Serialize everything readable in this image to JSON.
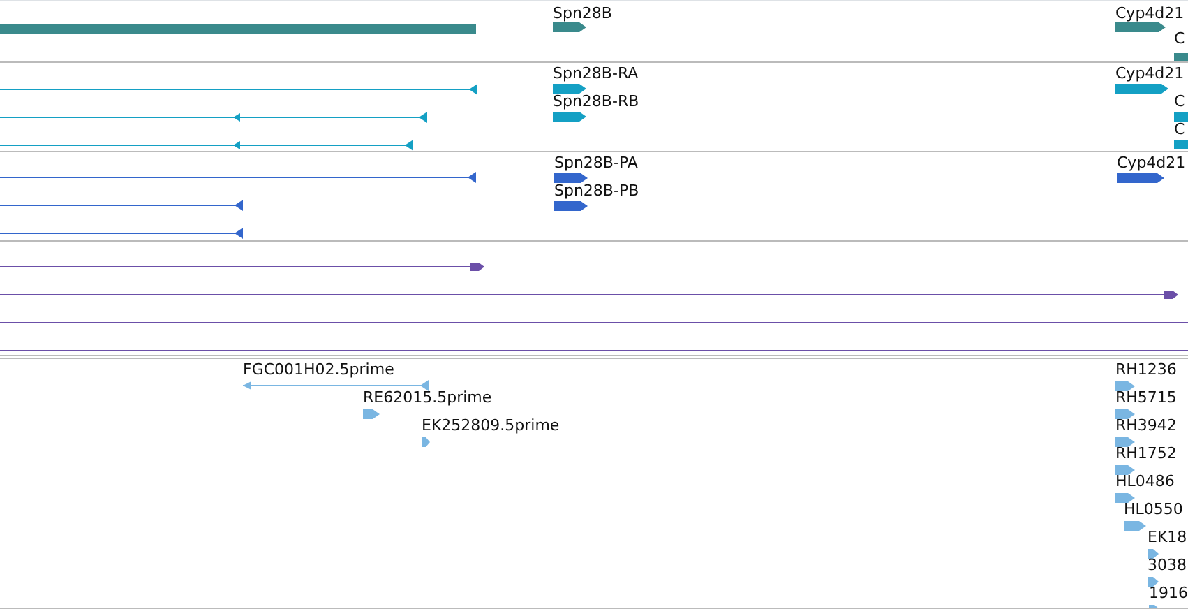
{
  "tracks": [
    {
      "color": "#3a8a8c",
      "features": [
        {
          "kind": "box",
          "arrowhead": false
        },
        {
          "label": "Spn28B",
          "kind": "box",
          "reverse": false,
          "arrowhead": true
        },
        {
          "label": "Cyp4d21",
          "kind": "box",
          "reverse": false,
          "arrowhead": true
        },
        {
          "label": "C",
          "kind": "box",
          "arrowhead": false
        }
      ]
    },
    {
      "color": "#14a0c4",
      "features": [
        {
          "kind": "line",
          "reverse": true,
          "arrowhead": true
        },
        {
          "kind": "line",
          "reverse": true,
          "arrowhead": true
        },
        {
          "kind": "line",
          "reverse": true,
          "arrowhead": true
        },
        {
          "label": "Spn28B-RA",
          "kind": "box",
          "reverse": false,
          "arrowhead": true
        },
        {
          "label": "Spn28B-RB",
          "kind": "box",
          "reverse": false,
          "arrowhead": true
        },
        {
          "label": "Cyp4d21",
          "kind": "box",
          "reverse": false,
          "arrowhead": true
        },
        {
          "label": "C",
          "kind": "box",
          "arrowhead": false
        },
        {
          "label": "C",
          "kind": "box",
          "arrowhead": false
        }
      ]
    },
    {
      "color": "#3366cc",
      "features": [
        {
          "kind": "line",
          "reverse": true,
          "arrowhead": true
        },
        {
          "kind": "line",
          "reverse": true,
          "arrowhead": true
        },
        {
          "kind": "line",
          "reverse": true,
          "arrowhead": true
        },
        {
          "label": "Spn28B-PA",
          "kind": "box",
          "reverse": false,
          "arrowhead": true
        },
        {
          "label": "Spn28B-PB",
          "kind": "box",
          "reverse": false,
          "arrowhead": true
        },
        {
          "label": "Cyp4d21",
          "kind": "box",
          "reverse": false,
          "arrowhead": true
        }
      ]
    },
    {
      "color": "#6b4fa8",
      "features": [
        {
          "kind": "line",
          "reverse": false,
          "arrowhead": true
        },
        {
          "kind": "line",
          "reverse": false,
          "arrowhead": true
        },
        {
          "kind": "line",
          "arrowhead": false
        },
        {
          "kind": "line",
          "arrowhead": false
        }
      ]
    },
    {
      "color": "#7ab6e2",
      "features": [
        {
          "label": "FGC001H02.5prime",
          "kind": "line",
          "reverse": true,
          "arrowhead": true
        },
        {
          "label": "RE62015.5prime",
          "kind": "box",
          "reverse": false,
          "arrowhead": true
        },
        {
          "label": "EK252809.5prime",
          "kind": "box",
          "reverse": false,
          "arrowhead": true
        },
        {
          "label": "RH1236",
          "kind": "box",
          "reverse": false,
          "arrowhead": true
        },
        {
          "label": "RH5715",
          "kind": "box",
          "reverse": false,
          "arrowhead": true
        },
        {
          "label": "RH3942",
          "kind": "box",
          "reverse": false,
          "arrowhead": true
        },
        {
          "label": "RH1752",
          "kind": "box",
          "reverse": false,
          "arrowhead": true
        },
        {
          "label": "HL0486",
          "kind": "box",
          "reverse": false,
          "arrowhead": true
        },
        {
          "label": "HL0550",
          "kind": "box",
          "reverse": false,
          "arrowhead": true
        },
        {
          "label": "EK18",
          "kind": "box",
          "reverse": false,
          "arrowhead": true
        },
        {
          "label": "3038",
          "kind": "box",
          "reverse": false,
          "arrowhead": true
        },
        {
          "label": "1916",
          "kind": "box",
          "reverse": false,
          "arrowhead": true
        }
      ]
    }
  ]
}
